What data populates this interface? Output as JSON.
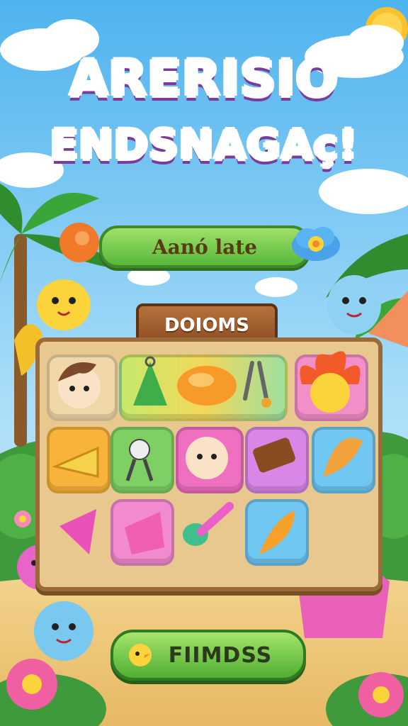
{
  "game": {
    "title_line1": "ARERISIO",
    "title_line2": "ENDSNAGAç!",
    "subtitle": "Aanó late",
    "board_sign": "DOIOMS",
    "play_button": "FIIMDSS"
  },
  "board": {
    "rows": [
      [
        "chibi-face",
        "triangle-bag",
        "mango",
        "tongs",
        "flame-spirit"
      ],
      [
        "cheese-slice",
        "robot-figure",
        "baby-face",
        "chocolate-bar",
        "feather-paint"
      ],
      [
        "pink-cone",
        "pink-bag",
        "paint-brush",
        "orange-leaf"
      ]
    ]
  },
  "colors": {
    "sky_top": "#59b9ef",
    "sky_bottom": "#bfe6fb",
    "board_wood": "#e9c88f",
    "button_green": "#58b83a",
    "title_orange": "#f7a32b",
    "title_pink": "#ec3f8a"
  }
}
